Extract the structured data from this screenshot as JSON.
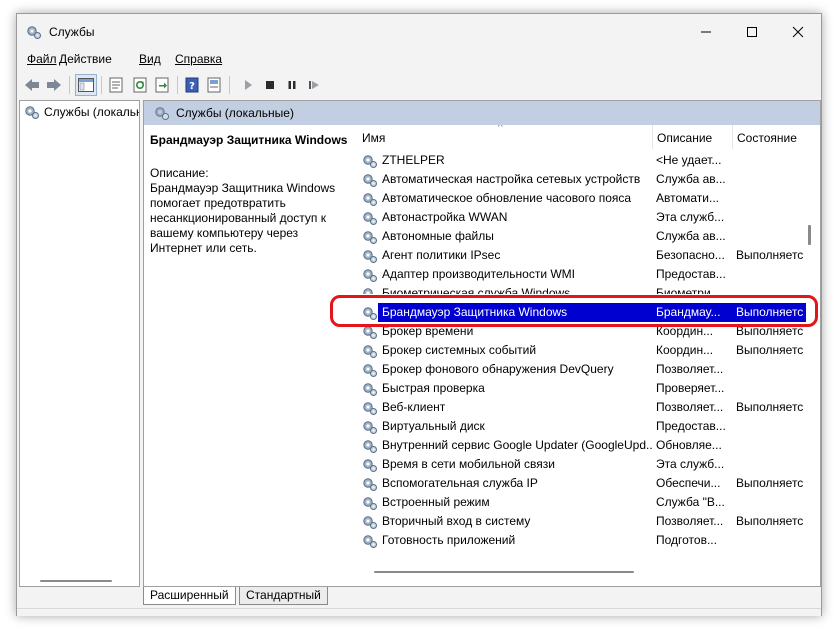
{
  "window": {
    "title": "Службы"
  },
  "menu": {
    "file": "Файл",
    "action": "Действие",
    "view": "Вид",
    "help": "Справка"
  },
  "tree": {
    "root": "Службы (локальн"
  },
  "main": {
    "header": "Службы (локальные)"
  },
  "description": {
    "service_name": "Брандмауэр Защитника Windows",
    "label": "Описание:",
    "text": "Брандмауэр Защитника Windows помогает предотвратить несанкционированный доступ к вашему компьютеру через Интернет или сеть."
  },
  "columns": {
    "name": "Имя",
    "description": "Описание",
    "state": "Состояние"
  },
  "services": [
    {
      "name": "ZTHELPER",
      "desc": "<Не удает...",
      "state": ""
    },
    {
      "name": "Автоматическая настройка сетевых устройств",
      "desc": "Служба ав...",
      "state": ""
    },
    {
      "name": "Автоматическое обновление часового пояса",
      "desc": "Автомати...",
      "state": ""
    },
    {
      "name": "Автонастройка WWAN",
      "desc": "Эта служб...",
      "state": ""
    },
    {
      "name": "Автономные файлы",
      "desc": "Служба ав...",
      "state": ""
    },
    {
      "name": "Агент политики IPsec",
      "desc": "Безопасно...",
      "state": "Выполняетс"
    },
    {
      "name": "Адаптер производительности WMI",
      "desc": "Предостав...",
      "state": ""
    },
    {
      "name": "Биометрическая служба Windows",
      "desc": "Биометри...",
      "state": ""
    },
    {
      "name": "Брандмауэр Защитника Windows",
      "desc": "Брандмау...",
      "state": "Выполняетс"
    },
    {
      "name": "Брокер времени",
      "desc": "Координ...",
      "state": "Выполняетс"
    },
    {
      "name": "Брокер системных событий",
      "desc": "Координ...",
      "state": "Выполняетс"
    },
    {
      "name": "Брокер фонового обнаружения DevQuery",
      "desc": "Позволяет...",
      "state": ""
    },
    {
      "name": "Быстрая проверка",
      "desc": "Проверяет...",
      "state": ""
    },
    {
      "name": "Веб-клиент",
      "desc": "Позволяет...",
      "state": "Выполняетс"
    },
    {
      "name": "Виртуальный диск",
      "desc": "Предостав...",
      "state": ""
    },
    {
      "name": "Внутренний сервис Google Updater (GoogleUpd...",
      "desc": "Обновляе...",
      "state": ""
    },
    {
      "name": "Время в сети мобильной связи",
      "desc": "Эта служб...",
      "state": ""
    },
    {
      "name": "Вспомогательная служба IP",
      "desc": "Обеспечи...",
      "state": "Выполняетс"
    },
    {
      "name": "Встроенный режим",
      "desc": "Служба \"В...",
      "state": ""
    },
    {
      "name": "Вторичный вход в систему",
      "desc": "Позволяет...",
      "state": "Выполняетс"
    },
    {
      "name": "Готовность приложений",
      "desc": "Подготов...",
      "state": ""
    }
  ],
  "tabs": {
    "extended": "Расширенный",
    "standard": "Стандартный"
  }
}
